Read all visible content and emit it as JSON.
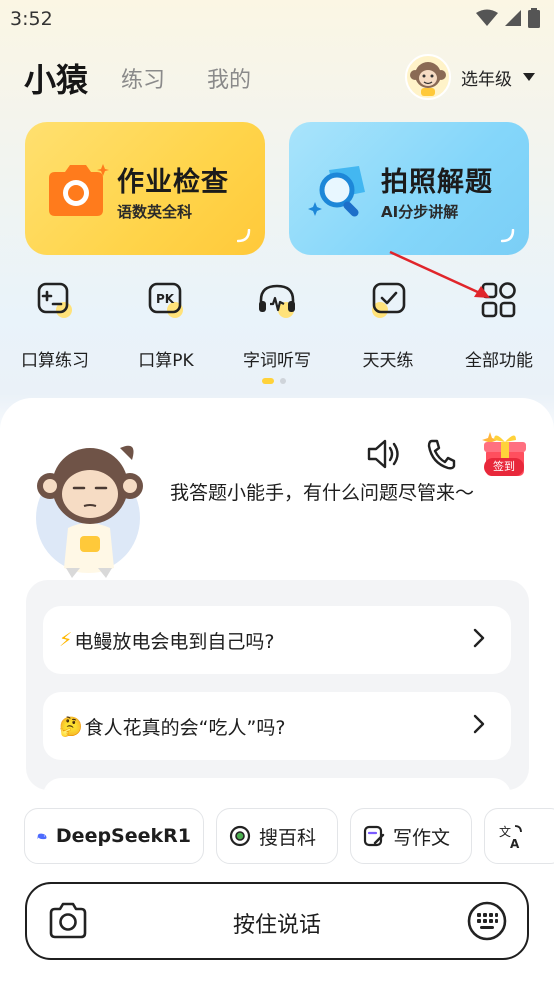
{
  "status_bar": {
    "time": "3:52"
  },
  "header": {
    "tabs": [
      {
        "label": "小猿",
        "active": true
      },
      {
        "label": "练习",
        "active": false
      },
      {
        "label": "我的",
        "active": false
      }
    ],
    "grade_selector": "选年级"
  },
  "feature_cards": [
    {
      "title": "作业检查",
      "subtitle": "语数英全科",
      "icon": "camera-icon",
      "color": "#ffd44a"
    },
    {
      "title": "拍照解题",
      "subtitle": "AI分步讲解",
      "icon": "magnifier-icon",
      "color": "#84d6fa"
    }
  ],
  "functions": [
    {
      "label": "口算练习",
      "icon": "calculator-card-icon"
    },
    {
      "label": "口算PK",
      "icon": "pk-icon"
    },
    {
      "label": "字词听写",
      "icon": "headphones-icon"
    },
    {
      "label": "天天练",
      "icon": "check-card-icon"
    },
    {
      "label": "全部功能",
      "icon": "grid-icon"
    }
  ],
  "carousel": {
    "pages": 2,
    "active": 1
  },
  "assistant": {
    "greeting": "我答题小能手，有什么问题尽管来～",
    "checkin_badge": "签到"
  },
  "questions": [
    {
      "emoji": "⚡",
      "text": "电鳗放电会电到自己吗?"
    },
    {
      "emoji": "🤔",
      "text": "食人花真的会“吃人”吗?"
    }
  ],
  "chips": [
    {
      "label": "DeepSeekR1",
      "icon": "whale-icon"
    },
    {
      "label": "搜百科",
      "icon": "target-icon"
    },
    {
      "label": "写作文",
      "icon": "pen-doc-icon"
    },
    {
      "label": "",
      "icon": "translate-icon"
    }
  ],
  "input_bar": {
    "label": "按住说话"
  },
  "colors": {
    "accent_yellow": "#ffd23a",
    "accent_blue": "#84d6fa",
    "annotation_red": "#e0252b"
  }
}
